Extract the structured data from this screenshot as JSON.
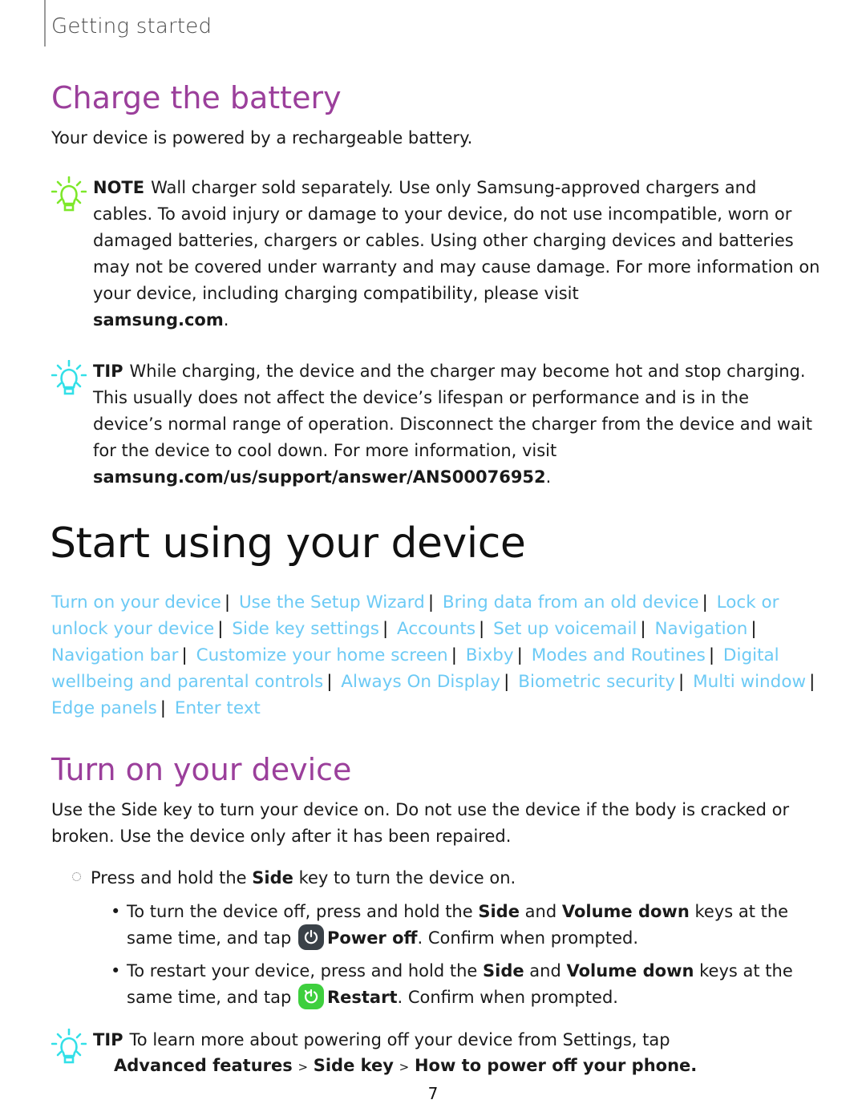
{
  "running_head": "Getting started",
  "charge": {
    "heading": "Charge the battery",
    "intro": "Your device is powered by a rechargeable battery.",
    "note": {
      "label": "NOTE",
      "text": "Wall charger sold separately. Use only Samsung-approved chargers and cables. To avoid injury or damage to your device, do not use incompatible, worn or damaged batteries, chargers or cables. Using other charging devices and batteries may not be covered under warranty and may cause damage. For more information on your device, including charging compatibility, please visit",
      "link": "samsung.com",
      "end": "."
    },
    "tip": {
      "label": "TIP",
      "text": "While charging, the device and the charger may become hot and stop charging. This usually does not affect the device’s lifespan or performance and is in the device’s normal range of operation. Disconnect the charger from the device and wait for the device to cool down. For more information, visit",
      "link": "samsung.com/us/support/answer/ANS00076952",
      "end": "."
    }
  },
  "start": {
    "title": "Start using your device",
    "links": [
      "Turn on your device",
      "Use the Setup Wizard",
      "Bring data from an old device",
      "Lock or unlock your device",
      "Side key settings",
      "Accounts",
      "Set up voicemail",
      "Navigation",
      "Navigation bar",
      "Customize your home screen",
      "Bixby",
      "Modes and Routines",
      "Digital wellbeing and parental controls",
      "Always On Display",
      "Biometric security",
      "Multi window",
      "Edge panels",
      "Enter text"
    ],
    "separator": "|"
  },
  "turn_on": {
    "heading": "Turn on your device",
    "intro": "Use the Side key to turn your device on. Do not use the device if the body is cracked or broken. Use the device only after it has been repaired.",
    "step": {
      "pre": "Press and hold the",
      "key": "Side",
      "post": "key to turn the device on."
    },
    "bullets": [
      {
        "pre": "To turn the device off, press and hold the",
        "k1": "Side",
        "and": "and",
        "k2": "Volume down",
        "mid": "keys at the same time, and tap",
        "icon": "power-off-icon",
        "action": "Power off",
        "post": ". Confirm when prompted."
      },
      {
        "pre": "To restart your device, press and hold the",
        "k1": "Side",
        "and": "and",
        "k2": "Volume down",
        "mid": "keys at the same time, and tap",
        "icon": "restart-icon",
        "action": "Restart",
        "post": ". Confirm when prompted."
      }
    ],
    "tip": {
      "label": "TIP",
      "text": "To learn more about powering off your device from Settings, tap",
      "path": [
        "Advanced features",
        "Side key",
        "How to power off your phone"
      ],
      "path_sep": ">",
      "end": "."
    }
  },
  "colors": {
    "heading": "#9b3f9b",
    "link": "#6ccaf5",
    "note_icon": "#7de82a",
    "tip_icon": "#33e0e8",
    "power_off_bg": "#3a4148",
    "restart_bg": "#3ecf3e"
  },
  "page_number": "7"
}
